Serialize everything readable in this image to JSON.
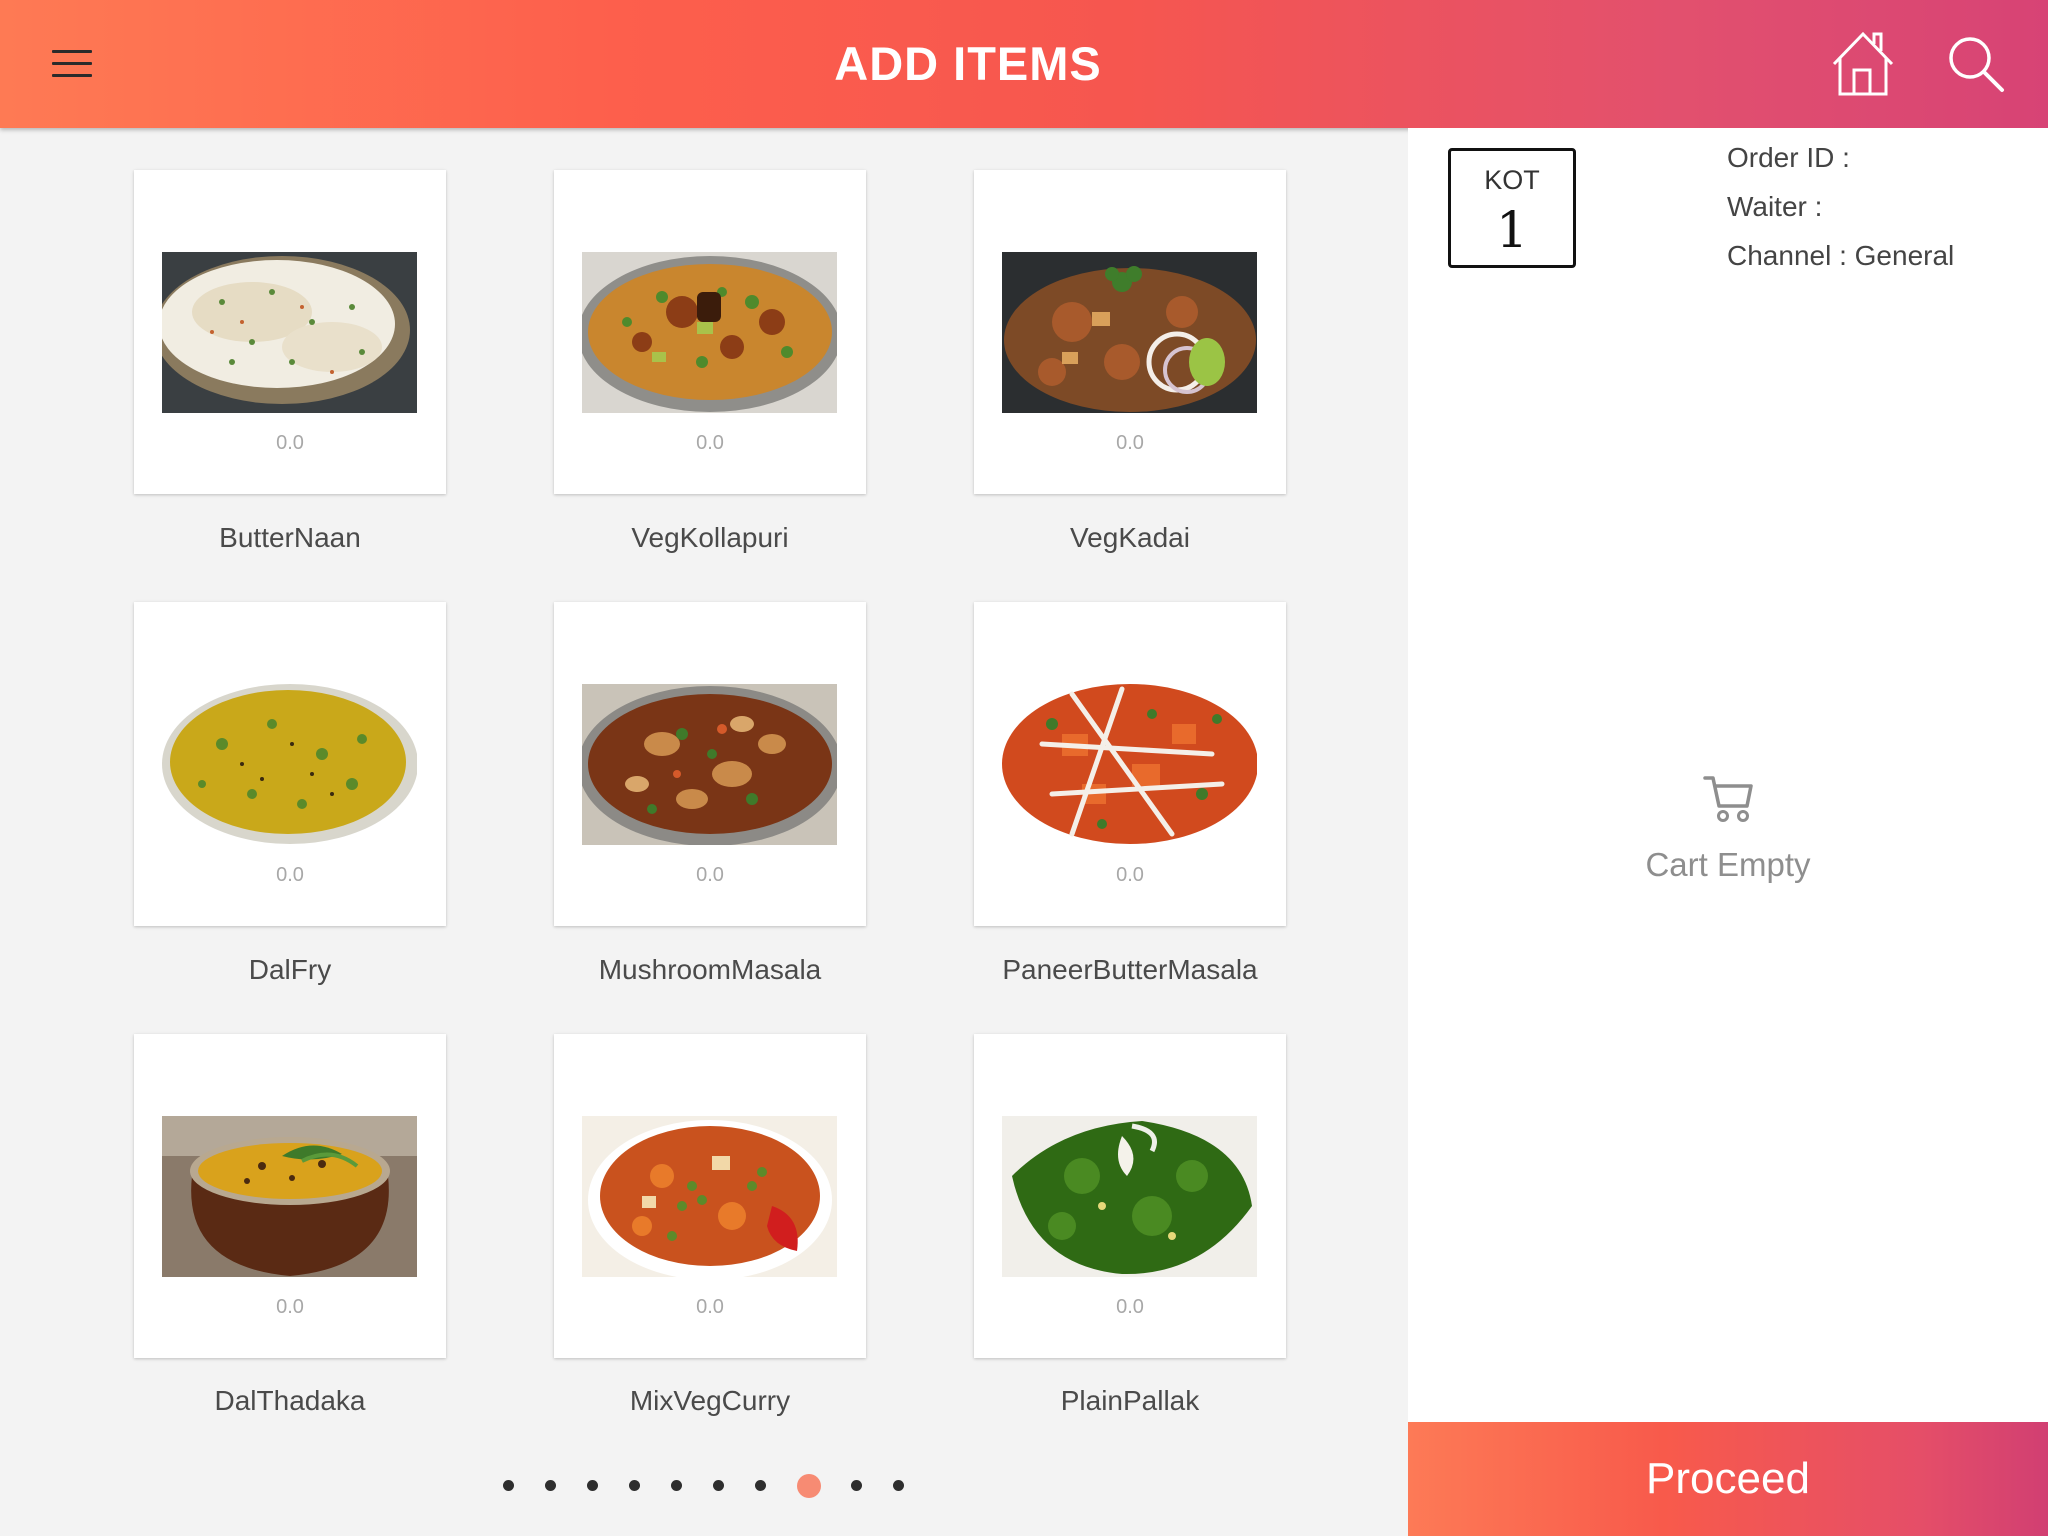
{
  "header": {
    "title": "ADD ITEMS",
    "menu_icon": "hamburger-icon",
    "home_icon": "home-icon",
    "search_icon": "search-icon",
    "gradient": [
      "#fe7a54",
      "#d74375"
    ]
  },
  "items": [
    {
      "name": "ButterNaan",
      "price": "0.0"
    },
    {
      "name": "VegKollapuri",
      "price": "0.0"
    },
    {
      "name": "VegKadai",
      "price": "0.0"
    },
    {
      "name": "DalFry",
      "price": "0.0"
    },
    {
      "name": "MushroomMasala",
      "price": "0.0"
    },
    {
      "name": "PaneerButterMasala",
      "price": "0.0"
    },
    {
      "name": "DalThadaka",
      "price": "0.0"
    },
    {
      "name": "MixVegCurry",
      "price": "0.0"
    },
    {
      "name": "PlainPallak",
      "price": "0.0"
    }
  ],
  "pagination": {
    "total_pages": 10,
    "current_page": 8,
    "active_color": "#f78b73"
  },
  "order": {
    "kot_label": "KOT",
    "kot_number": "1",
    "order_id_label": "Order ID :",
    "waiter_label": "Waiter :",
    "channel_label": "Channel : General"
  },
  "cart": {
    "icon": "cart-icon",
    "empty_text": "Cart Empty"
  },
  "actions": {
    "proceed_label": "Proceed"
  }
}
